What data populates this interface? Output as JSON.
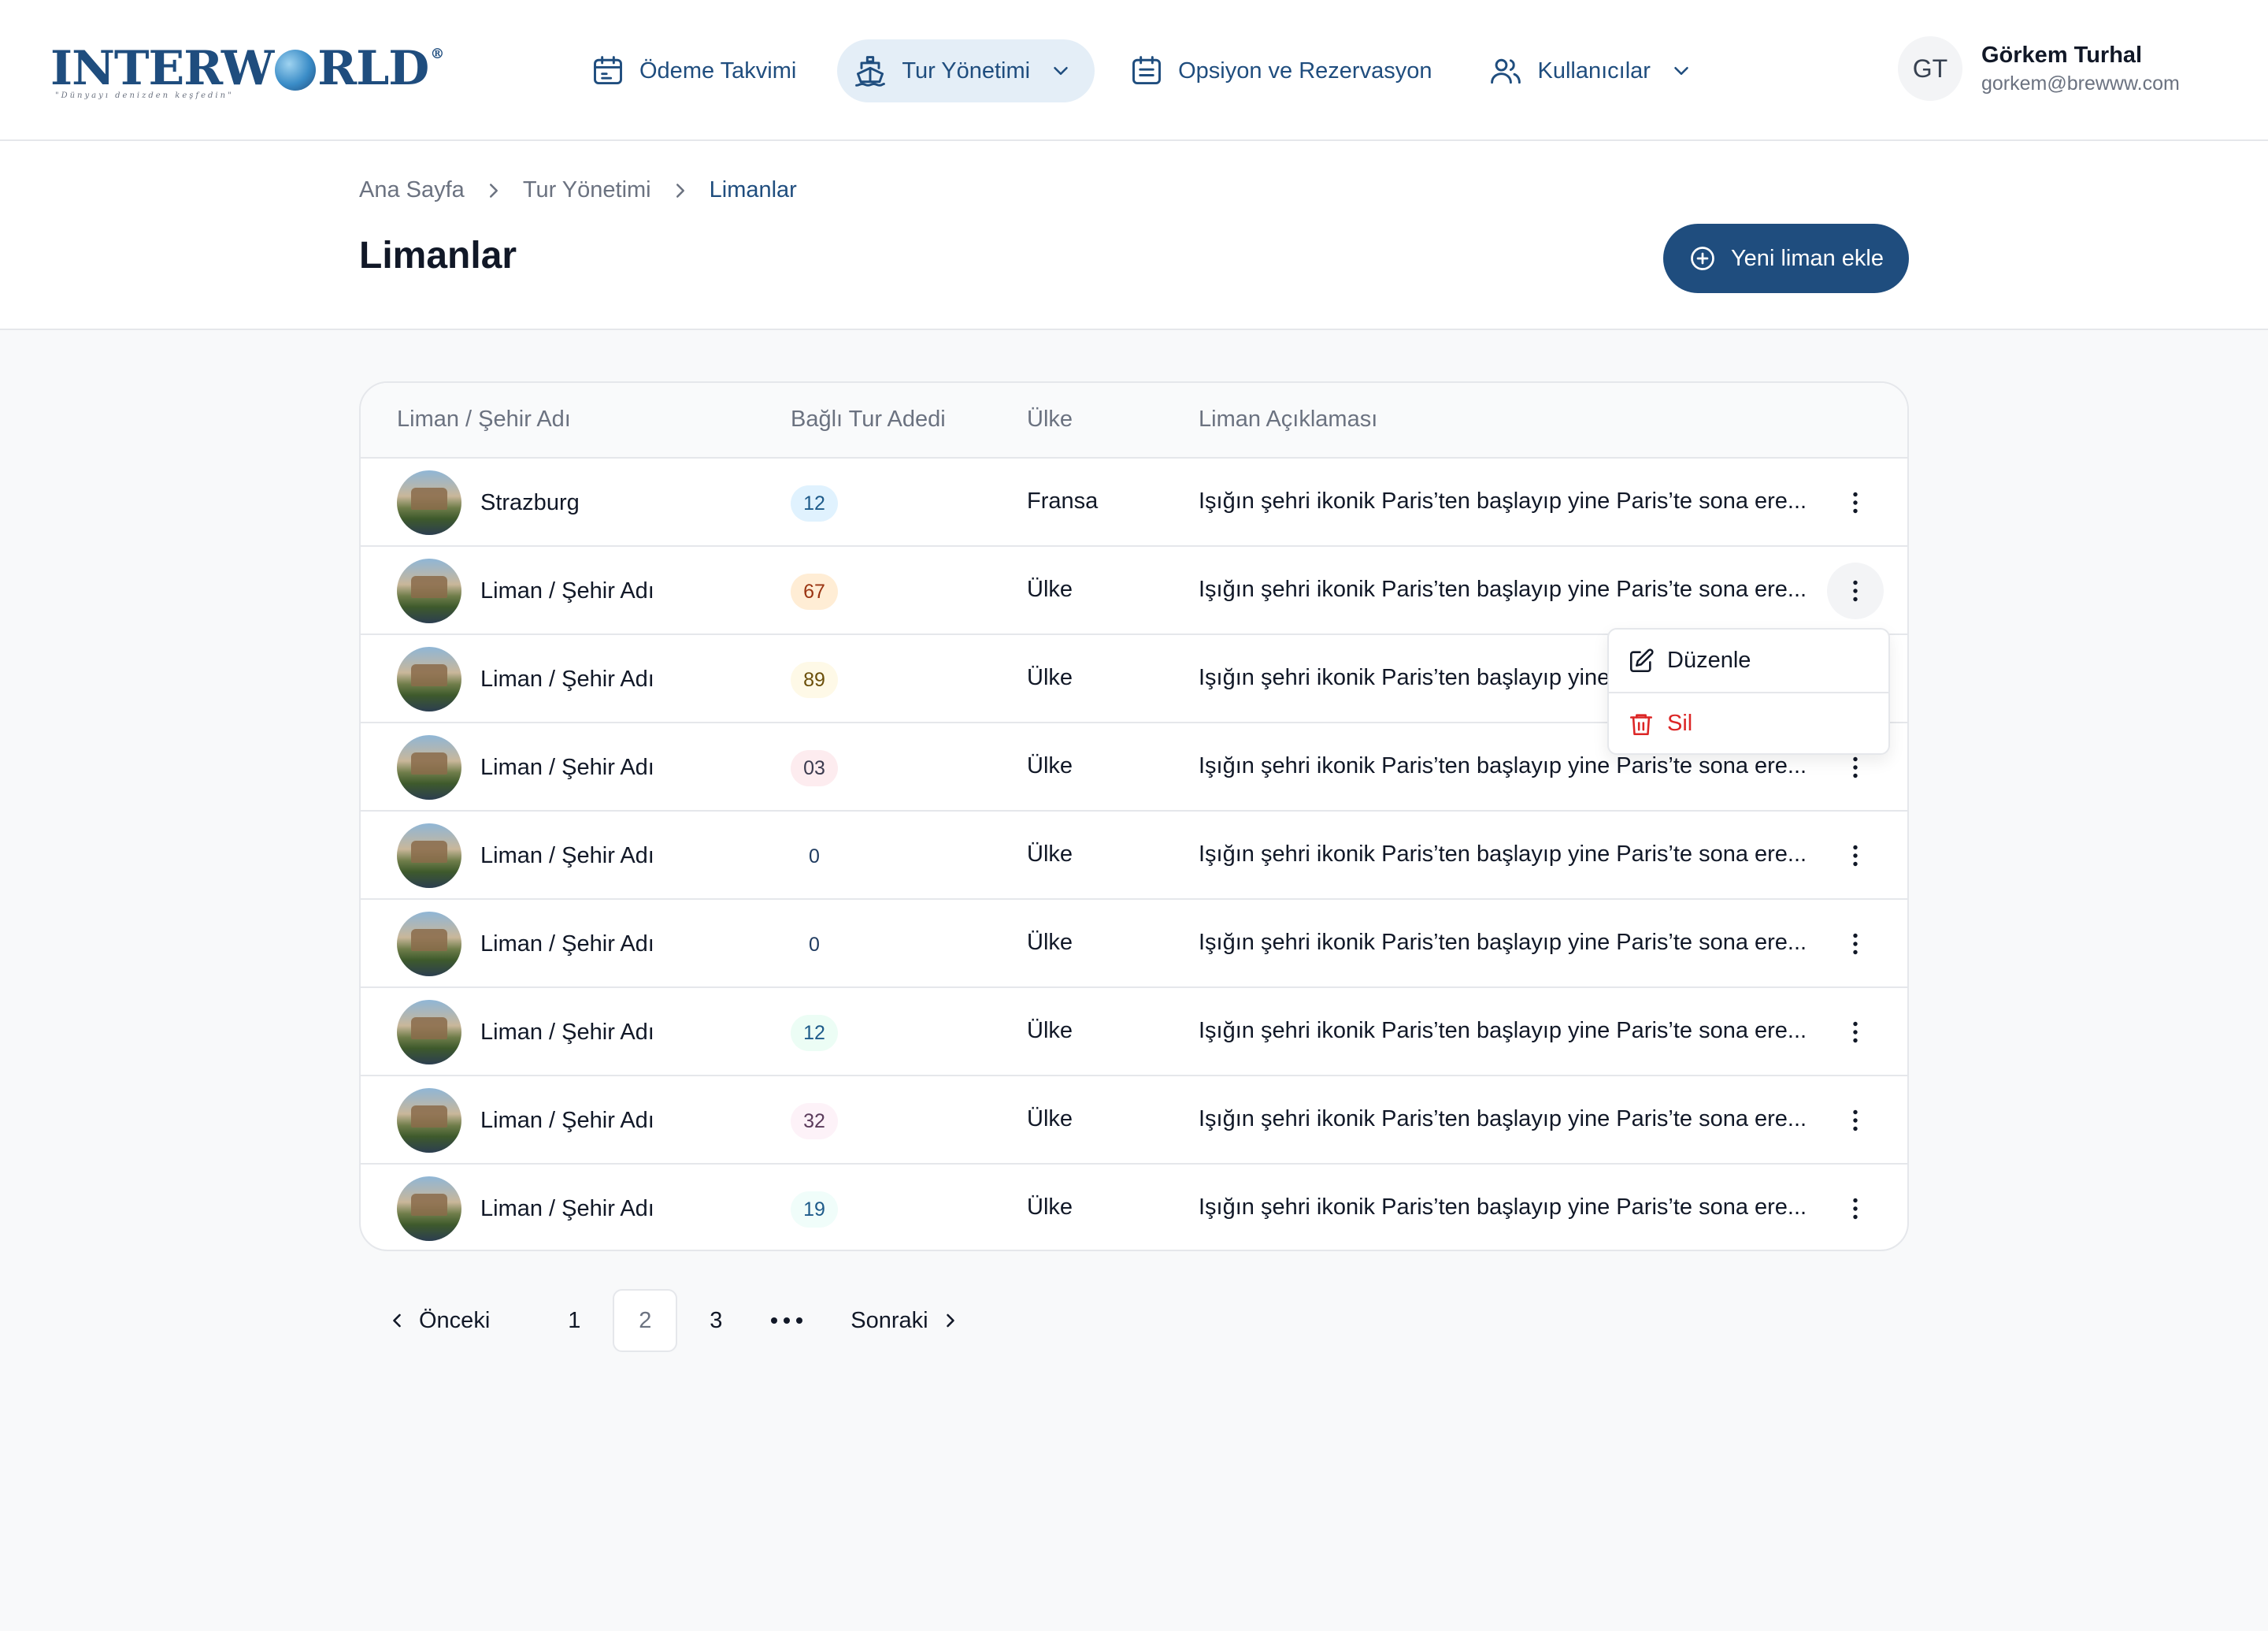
{
  "logo": {
    "text_left": "INTERW",
    "text_right": "RLD",
    "reg": "®",
    "tagline": "\"Dünyayı denizden keşfedin\""
  },
  "nav": [
    {
      "label": "Ödeme Takvimi",
      "icon": "calendar-icon",
      "active": false,
      "dropdown": false
    },
    {
      "label": "Tur Yönetimi",
      "icon": "ship-icon",
      "active": true,
      "dropdown": true
    },
    {
      "label": "Opsiyon ve Rezervasyon",
      "icon": "calendar-list-icon",
      "active": false,
      "dropdown": false
    },
    {
      "label": "Kullanıcılar",
      "icon": "users-icon",
      "active": false,
      "dropdown": true
    }
  ],
  "user": {
    "initials": "GT",
    "name": "Görkem Turhal",
    "email": "gorkem@brewww.com"
  },
  "breadcrumb": [
    "Ana Sayfa",
    "Tur Yönetimi",
    "Limanlar"
  ],
  "page": {
    "title": "Limanlar",
    "add_button": "Yeni liman ekle"
  },
  "table": {
    "headers": [
      "Liman / Şehir Adı",
      "Bağlı Tur Adedi",
      "Ülke",
      "Liman Açıklaması"
    ],
    "rows": [
      {
        "name": "Strazburg",
        "count": "12",
        "badge_bg": "#e0f2fe",
        "badge_fg": "#1e5b8a",
        "country": "Fransa",
        "desc": "Işığın şehri ikonik Paris’ten başlayıp yine Paris’te sona ere..."
      },
      {
        "name": "Liman / Şehir Adı",
        "count": "67",
        "badge_bg": "#ffedd5",
        "badge_fg": "#9a3412",
        "country": "Ülke",
        "desc": "Işığın şehri ikonik Paris’ten başlayıp yine Paris’te sona ere..."
      },
      {
        "name": "Liman / Şehir Adı",
        "count": "89",
        "badge_bg": "#fef9e7",
        "badge_fg": "#6b4f0a",
        "country": "Ülke",
        "desc": "Işığın şehri ikonik Paris’ten başlayıp yine Paris’te sona ere..."
      },
      {
        "name": "Liman / Şehir Adı",
        "count": "03",
        "badge_bg": "#fdecef",
        "badge_fg": "#3b3b4f",
        "country": "Ülke",
        "desc": "Işığın şehri ikonik Paris’ten başlayıp yine Paris’te sona ere..."
      },
      {
        "name": "Liman / Şehir Adı",
        "count": "0",
        "badge_bg": "#ffffff",
        "badge_fg": "#1e3a5f",
        "country": "Ülke",
        "desc": "Işığın şehri ikonik Paris’ten başlayıp yine Paris’te sona ere..."
      },
      {
        "name": "Liman / Şehir Adı",
        "count": "0",
        "badge_bg": "#ffffff",
        "badge_fg": "#1e3a5f",
        "country": "Ülke",
        "desc": "Işığın şehri ikonik Paris’ten başlayıp yine Paris’te sona ere..."
      },
      {
        "name": "Liman / Şehir Adı",
        "count": "12",
        "badge_bg": "#ecfdf5",
        "badge_fg": "#1e5b8a",
        "country": "Ülke",
        "desc": "Işığın şehri ikonik Paris’ten başlayıp yine Paris’te sona ere..."
      },
      {
        "name": "Liman / Şehir Adı",
        "count": "32",
        "badge_bg": "#fdf2f8",
        "badge_fg": "#5b3b5b",
        "country": "Ülke",
        "desc": "Işığın şehri ikonik Paris’ten başlayıp yine Paris’te sona ere..."
      },
      {
        "name": "Liman / Şehir Adı",
        "count": "19",
        "badge_bg": "#f0fdfa",
        "badge_fg": "#1e5b8a",
        "country": "Ülke",
        "desc": "Işığın şehri ikonik Paris’ten başlayıp yine Paris’te sona ere..."
      }
    ]
  },
  "row_menu": {
    "edit": "Düzenle",
    "delete": "Sil",
    "open_row": 2
  },
  "pagination": {
    "prev": "Önceki",
    "next": "Sonraki",
    "pages": [
      "1",
      "2",
      "3"
    ],
    "current": "2"
  },
  "colors": {
    "primary": "#1f4d7e",
    "danger": "#dc2626",
    "nav_active_bg": "#e4eef7"
  }
}
